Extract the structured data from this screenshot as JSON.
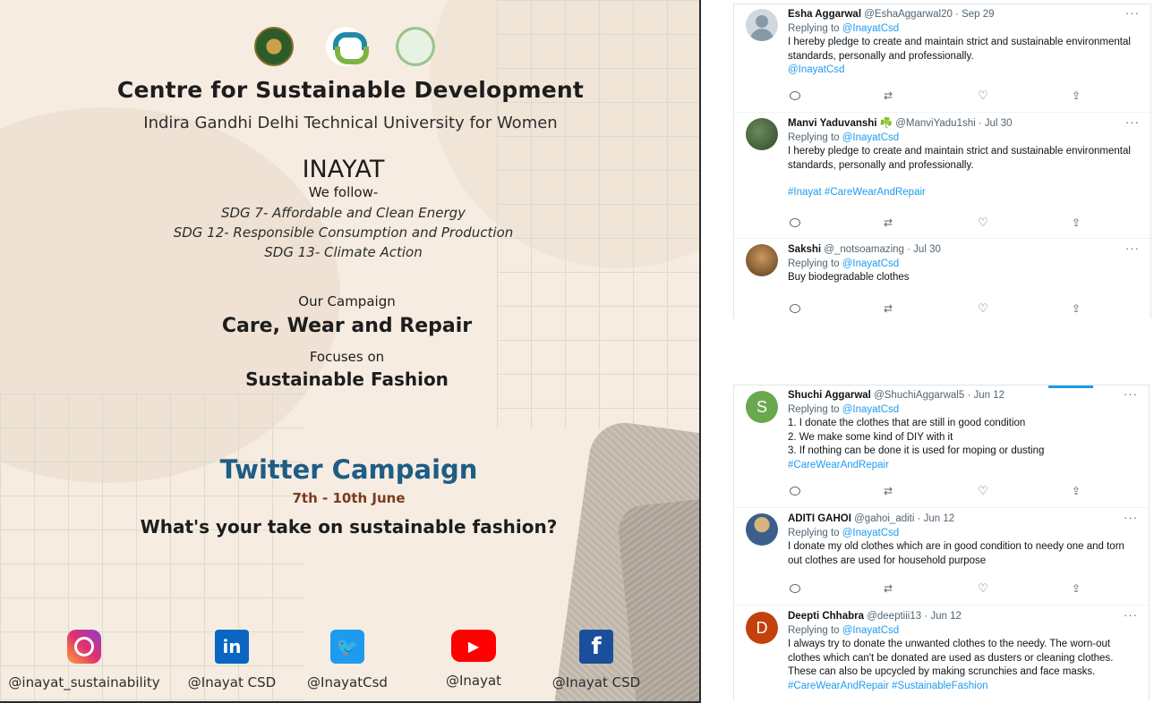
{
  "poster": {
    "title": "Centre for Sustainable Development",
    "university": "Indira Gandhi Delhi Technical University for Women",
    "inayat": "INAYAT",
    "we_follow": "We follow-",
    "sdgs": [
      "SDG 7- Affordable and Clean Energy",
      "SDG 12- Responsible Consumption and Production",
      "SDG 13- Climate Action"
    ],
    "our_campaign": "Our Campaign",
    "campaign_name": "Care, Wear and Repair",
    "focuses_on": "Focuses on",
    "focus": "Sustainable Fashion",
    "twitter_campaign": "Twitter Campaign",
    "dates": "7th - 10th June",
    "question": "What's your take on sustainable fashion?",
    "logos": [
      "igdtuw-logo",
      "csd-logo",
      "inayat-logo"
    ],
    "accent_color": "#1d5d86",
    "socials": [
      {
        "icon": "instagram-icon",
        "label": "@inayat_sustainability"
      },
      {
        "icon": "linkedin-icon",
        "glyph": "in",
        "label": "@Inayat CSD"
      },
      {
        "icon": "twitter-icon",
        "glyph": "🐦",
        "label": "@InayatCsd"
      },
      {
        "icon": "youtube-icon",
        "glyph": "▶",
        "label": "@Inayat"
      },
      {
        "icon": "facebook-icon",
        "glyph": "f",
        "label": "@Inayat CSD"
      }
    ]
  },
  "tweets_top": [
    {
      "name": "Esha Aggarwal",
      "handle": "@EshaAggarwal20 · Sep 29",
      "replying": "Replying to",
      "reply_to": "@InayatCsd",
      "text": "I hereby pledge to create and maintain strict and sustainable environmental standards, personally and professionally.",
      "extra": "@InayatCsd"
    },
    {
      "name": "Manvi Yaduvanshi ☘️",
      "handle": "@ManviYadu1shi · Jul 30",
      "replying": "Replying to",
      "reply_to": "@InayatCsd",
      "text": "I hereby pledge to create and maintain strict and sustainable environmental standards, personally and professionally.",
      "extra": "#Inayat #CareWearAndRepair"
    },
    {
      "name": "Sakshi",
      "handle": "@_notsoamazing · Jul 30",
      "replying": "Replying to",
      "reply_to": "@InayatCsd",
      "text": "Buy biodegradable clothes",
      "extra": ""
    }
  ],
  "tweets_bottom": [
    {
      "avatar_letter": "S",
      "name": "Shuchi Aggarwal",
      "handle": "@ShuchiAggarwal5 · Jun 12",
      "replying": "Replying to",
      "reply_to": "@InayatCsd",
      "text": "1. I donate the clothes that are still in good condition\n2. We make some kind of DIY with it\n3. If nothing can be done it is used for moping or dusting",
      "extra": "#CareWearAndRepair"
    },
    {
      "name": "ADITI GAHOI",
      "handle": "@gahoi_aditi · Jun 12",
      "replying": "Replying to",
      "reply_to": "@InayatCsd",
      "text": "I donate my old clothes which are in good condition to needy one and torn out clothes are used for household purpose",
      "extra": ""
    },
    {
      "avatar_letter": "D",
      "name": "Deepti Chhabra",
      "handle": "@deeptiii13 · Jun 12",
      "replying": "Replying to",
      "reply_to": "@InayatCsd",
      "text": "I always try to donate the unwanted clothes to the needy. The worn-out clothes which can't be donated are used as dusters or cleaning clothes. These can also be upcycled by making scrunchies and face masks.",
      "extra": "#CareWearAndRepair #SustainableFashion"
    }
  ],
  "action_icons": [
    "reply-icon",
    "retweet-icon",
    "like-icon",
    "share-icon"
  ],
  "colors": {
    "link": "#1d9bf0",
    "muted": "#536471"
  }
}
